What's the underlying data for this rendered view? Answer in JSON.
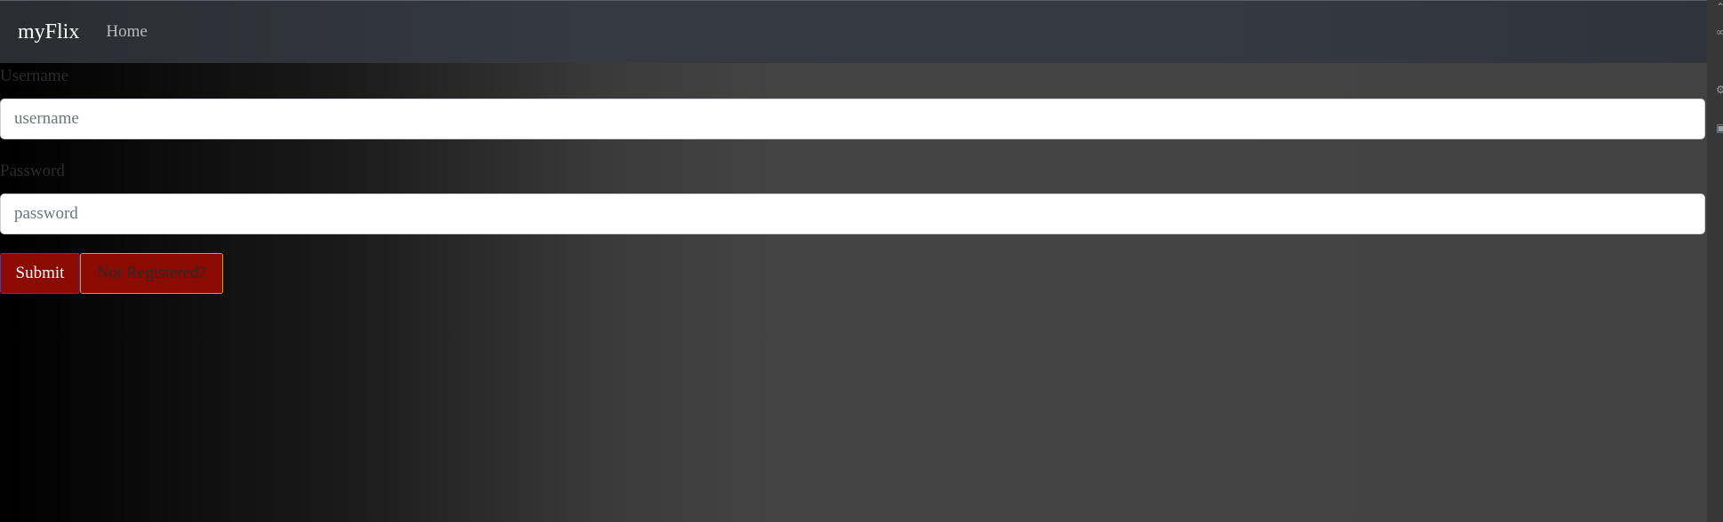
{
  "navbar": {
    "brand": "myFlix",
    "home": "Home"
  },
  "form": {
    "username_label": "Username",
    "username_placeholder": "username",
    "password_label": "Password",
    "password_placeholder": "password",
    "submit_label": "Submit",
    "register_label": "Not Registered?"
  },
  "colors": {
    "button_bg": "#8b0a02",
    "navbar_bg": "#343a40",
    "submit_border": "#3d3fbf",
    "register_border": "#d4a010"
  }
}
